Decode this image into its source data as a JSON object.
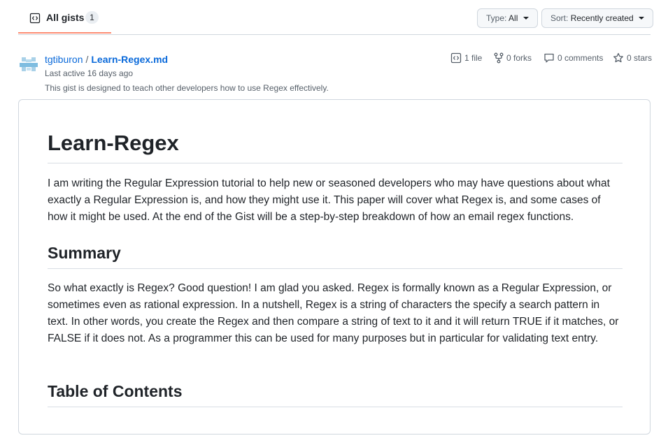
{
  "tabs": {
    "all_gists": {
      "label": "All gists",
      "count": "1"
    }
  },
  "filters": {
    "type": {
      "prefix": "Type:",
      "value": "All"
    },
    "sort": {
      "prefix": "Sort:",
      "value": "Recently created"
    }
  },
  "gist": {
    "owner": "tgtiburon",
    "separator": "/",
    "filename": "Learn-Regex.md",
    "last_active": "Last active 16 days ago",
    "description": "This gist is designed to teach other developers how to use Regex effectively.",
    "stats": {
      "files": "1 file",
      "forks": "0 forks",
      "comments": "0 comments",
      "stars": "0 stars"
    }
  },
  "content": {
    "h1": "Learn-Regex",
    "intro": "I am writing the Regular Expression tutorial to help new or seasoned developers who may have questions about what exactly a Regular Expression is, and how they might use it. This paper will cover what Regex is, and some cases of how it might be used. At the end of the Gist will be a step-by-step breakdown of how an email regex functions.",
    "summary_heading": "Summary",
    "summary": "So what exactly is Regex? Good question! I am glad you asked. Regex is formally known as a Regular Expression, or sometimes even as rational expression. In a nutshell, Regex is a string of characters the specify a search pattern in text. In other words, you create the Regex and then compare a string of text to it and it will return TRUE if it matches, or FALSE if it does not. As a programmer this can be used for many purposes but in particular for validating text entry.",
    "toc_heading": "Table of Contents"
  },
  "colors": {
    "link": "#0969da",
    "tab_underline": "#fd8c73",
    "muted": "#57606a",
    "border": "#d0d7de"
  },
  "icons": [
    "code-square-icon",
    "file-code-icon",
    "fork-icon",
    "comment-icon",
    "star-icon",
    "caret-down-icon"
  ]
}
